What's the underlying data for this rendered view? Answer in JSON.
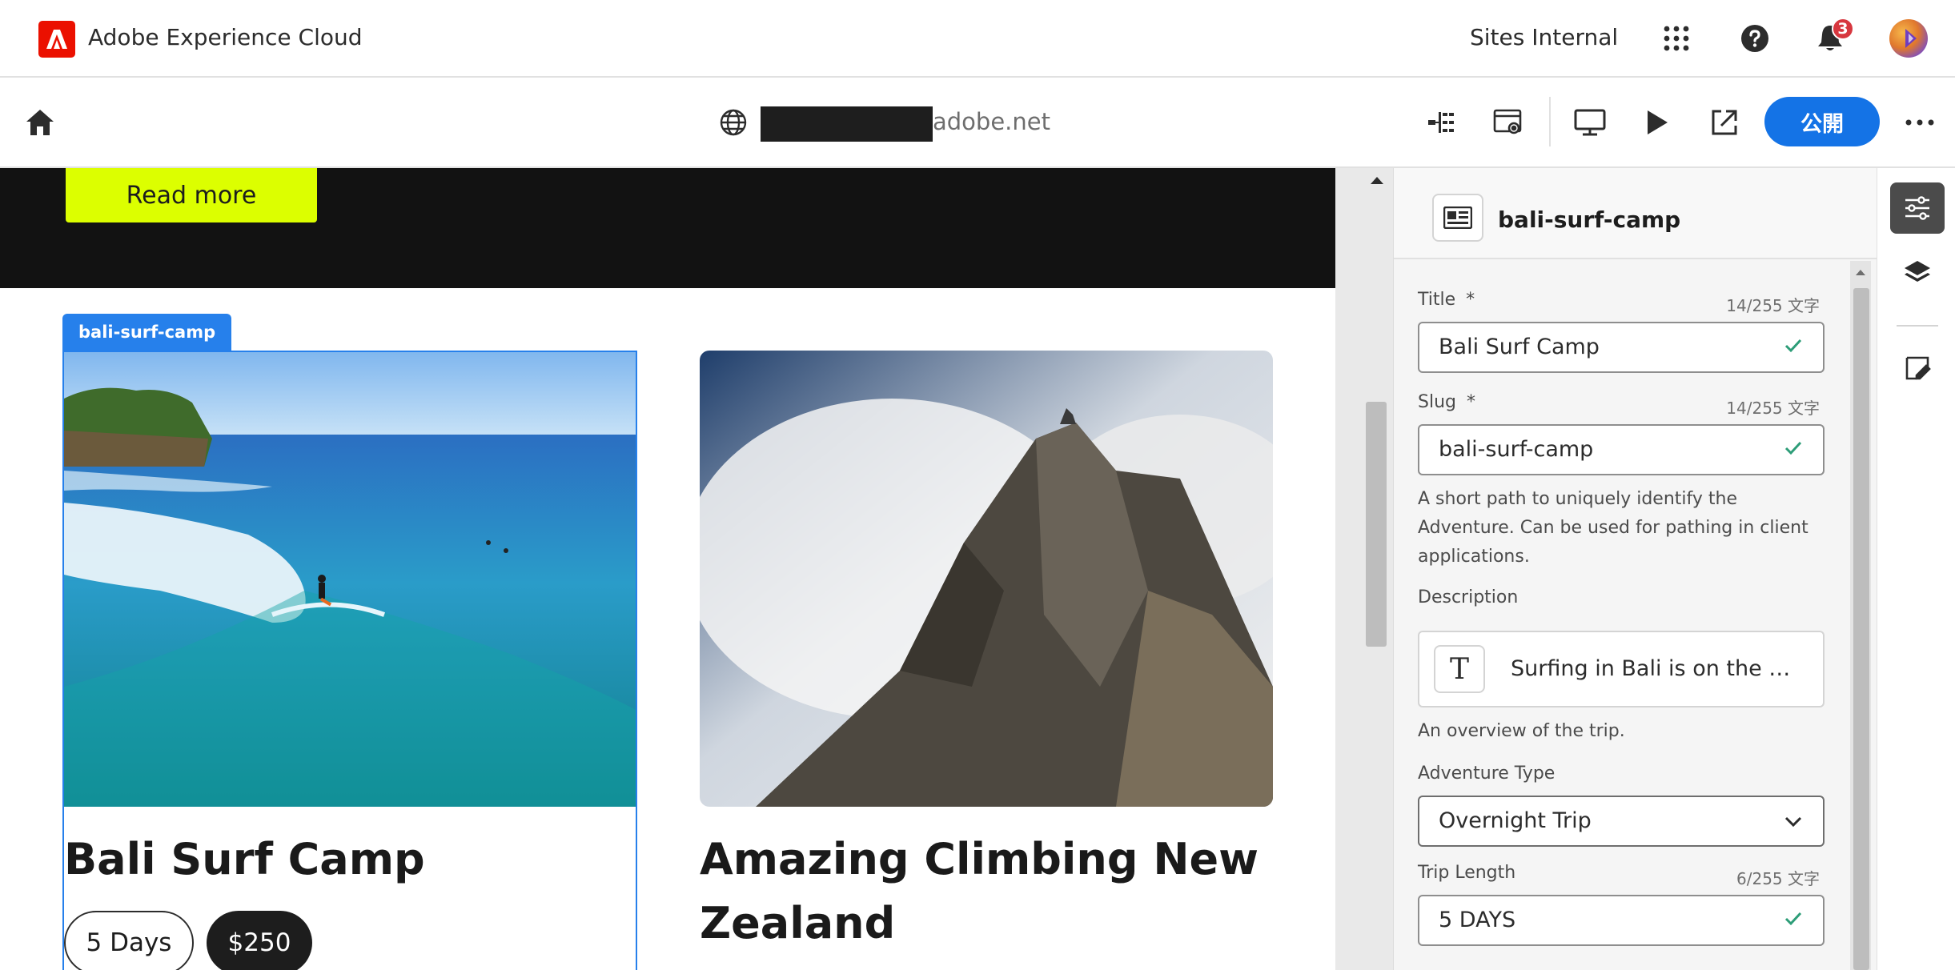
{
  "shell": {
    "app_name": "Adobe Experience Cloud",
    "org_name": "Sites Internal",
    "notification_count": "3",
    "icons": [
      "apps-grid-icon",
      "help-icon",
      "bell-icon",
      "avatar"
    ]
  },
  "toolbar": {
    "url_suffix": "adobe.net",
    "publish_label": "公開",
    "icons": [
      "home-icon",
      "globe-icon",
      "content-tree-icon",
      "page-properties-icon",
      "desktop-icon",
      "play-icon",
      "open-external-icon",
      "more-icon"
    ]
  },
  "canvas": {
    "read_more_label": "Read more",
    "selected_tag": "bali-surf-camp",
    "cards": [
      {
        "title": "Bali Surf Camp",
        "pills": [
          "5 Days",
          "$250"
        ]
      },
      {
        "title_line1": "Amazing Climbing New",
        "title_line2": "Zealand"
      }
    ]
  },
  "panel": {
    "header_title": "bali-surf-camp",
    "fields": {
      "title": {
        "label": "Title",
        "required": "*",
        "count": "14/255 文字",
        "value": "Bali Surf Camp"
      },
      "slug": {
        "label": "Slug",
        "required": "*",
        "count": "14/255 文字",
        "value": "bali-surf-camp",
        "help_line1": "A short path to uniquely identify the",
        "help_line2": "Adventure. Can be used for pathing in client",
        "help_line3": "applications."
      },
      "description": {
        "label": "Description",
        "value": "Surfing in Bali is on the …",
        "help": "An overview of the trip."
      },
      "adventure_type": {
        "label": "Adventure Type",
        "value": "Overnight Trip"
      },
      "trip_length": {
        "label": "Trip Length",
        "count": "6/255 文字",
        "value": "5 DAYS"
      }
    }
  },
  "rail": {
    "icons": [
      "properties-icon",
      "layers-icon",
      "annotate-icon"
    ]
  },
  "colors": {
    "accent_blue": "#1473e6",
    "selection_blue": "#2680eb",
    "read_more_bg": "#dcff00",
    "brand_red": "#eb1000",
    "check_green": "#2d9d78",
    "dark_band": "#121212"
  }
}
